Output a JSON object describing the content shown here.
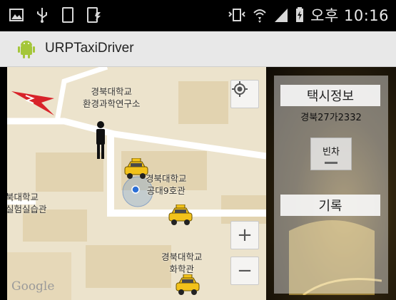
{
  "status_bar": {
    "time": "오후 10:16",
    "left_icons": [
      "image-icon",
      "usb-icon",
      "sim-card-icon",
      "phone-charging-icon"
    ],
    "right_icons": [
      "vibrate-icon",
      "wifi-icon",
      "signal-icon",
      "battery-charging-icon"
    ]
  },
  "app": {
    "title": "URPTaxiDriver",
    "icon": "android-icon"
  },
  "map": {
    "labels": [
      {
        "line1": "경북대학교",
        "line2": "환경과학연구소"
      },
      {
        "line1": "경북대학교",
        "line2": "공대9호관"
      },
      {
        "line1": "북대학교",
        "line2": "실험실습관"
      },
      {
        "line1": "경북대학교",
        "line2": "화학관"
      }
    ],
    "zoom_in_label": "+",
    "zoom_out_label": "−",
    "attribution": "Google",
    "icons": [
      "compass-icon",
      "pegman-icon",
      "my-location-icon",
      "current-location-marker-icon",
      "taxi-icon"
    ]
  },
  "panel": {
    "taxi_info_title": "택시정보",
    "plate_number": "경북27가2332",
    "status_button_label": "빈차",
    "records_title": "기록"
  },
  "colors": {
    "map_background": "#ece3cc",
    "road": "#ffffff",
    "building": "#e2d3b0",
    "compass_red": "#d8232a",
    "taxi_yellow": "#f2c21b",
    "panel_dark": "#2e230e"
  }
}
